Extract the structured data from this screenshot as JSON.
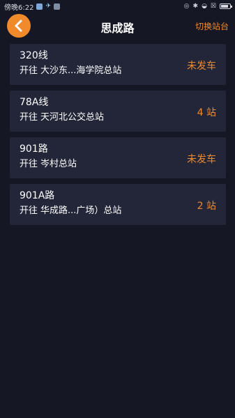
{
  "status_bar": {
    "time": "傍晚6:22",
    "battery_level": 0.8
  },
  "header": {
    "title": "思成路",
    "switch_label": "切换站台"
  },
  "direction_prefix": "开往",
  "routes": [
    {
      "name": "320线",
      "destination": "大沙东...海学院总站",
      "status": "未发车"
    },
    {
      "name": "78A线",
      "destination": "天河北公交总站",
      "status": "4 站"
    },
    {
      "name": "901路",
      "destination": "岑村总站",
      "status": "未发车"
    },
    {
      "name": "901A路",
      "destination": "华成路...广场）总站",
      "status": "2 站"
    }
  ],
  "colors": {
    "accent": "#f08a2a",
    "background": "#151725",
    "card": "#232638"
  }
}
